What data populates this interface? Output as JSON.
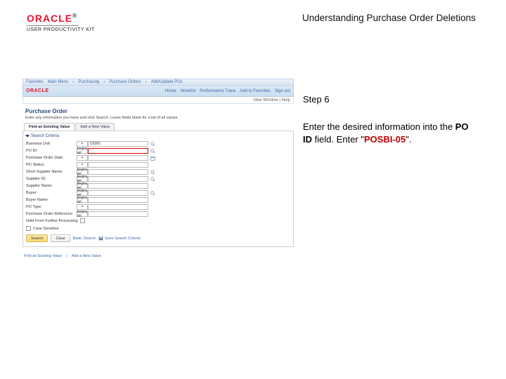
{
  "header": {
    "brand": "ORACLE",
    "upk": "USER PRODUCTIVITY KIT",
    "title": "Understanding Purchase Order Deletions"
  },
  "right": {
    "step": "Step 6",
    "instr_p1": "Enter the desired information into the ",
    "instr_field": "PO ID",
    "instr_p2": " field. Enter \"",
    "instr_value": "POSBI-05",
    "instr_p3": "\"."
  },
  "app": {
    "nav1": {
      "i0": "Favorites",
      "i1": "Main Menu",
      "i2": "Purchasing",
      "i3": "Purchase Orders",
      "i4": "Add/Update POs"
    },
    "nav2": {
      "r0": "Home",
      "r1": "Worklist",
      "r2": "Performance Trace",
      "r3": "Add to Favorites",
      "r4": "Sign out"
    },
    "status": "New Window | Help",
    "page_title": "Purchase Order",
    "intro": "Enter any information you have and click Search. Leave fields blank for a list of all values.",
    "tab_find": "Find an Existing Value",
    "tab_add": "Add a New Value",
    "section": "Search Criteria",
    "labels": {
      "business_unit": "Business Unit:",
      "po_id": "PO ID:",
      "po_date": "Purchase Order Date:",
      "po_status": "PO Status:",
      "short_supplier": "Short Supplier Name:",
      "supplier_id": "Supplier ID:",
      "supplier_name": "Supplier Name:",
      "buyer": "Buyer:",
      "buyer_name": "Buyer Name:",
      "po_type": "PO Type:",
      "auth": "Purchase Order Reference:",
      "hold": "Hold From Further Processing",
      "case": "Case Sensitive"
    },
    "ops": {
      "eq": "=",
      "begins": "begins wit",
      "between": "="
    },
    "values": {
      "business_unit": "US001"
    },
    "buttons": {
      "search": "Search",
      "clear": "Clear",
      "basic": "Basic Search",
      "save": "Save Search Criteria"
    },
    "footer": {
      "find": "Find an Existing Value",
      "add": "Add a New Value"
    }
  }
}
